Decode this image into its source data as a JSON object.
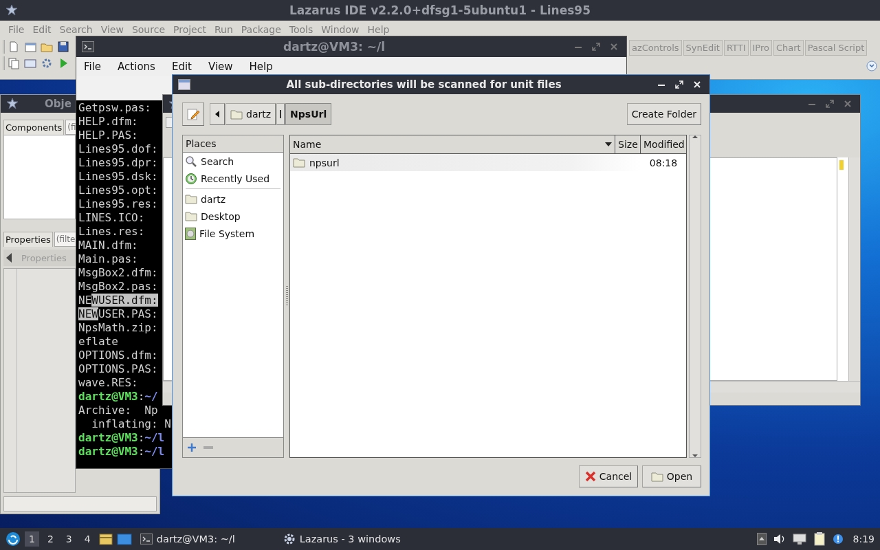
{
  "ide_window": {
    "title": "Lazarus IDE v2.2.0+dfsg1-5ubuntu1 - Lines95",
    "menu": [
      "File",
      "Edit",
      "Search",
      "View",
      "Source",
      "Project",
      "Run",
      "Package",
      "Tools",
      "Window",
      "Help"
    ],
    "palette_tabs": [
      "azControls",
      "SynEdit",
      "RTTI",
      "IPro",
      "Chart",
      "Pascal Script"
    ]
  },
  "object_inspector": {
    "title": "Obje",
    "components_tab": "Components",
    "components_filter": {
      "placeholder": "(fi"
    },
    "properties_tab": "Properties",
    "properties_filter": {
      "placeholder": "(filte"
    },
    "grid_header": "Properties"
  },
  "terminal": {
    "title": "dartz@VM3: ~/l",
    "menu": [
      "File",
      "Actions",
      "Edit",
      "View",
      "Help"
    ],
    "lines": [
      [
        {
          "text": "Getpsw.pas:",
          "kind": "plain"
        }
      ],
      [
        {
          "text": "HELP.dfm:",
          "kind": "plain"
        }
      ],
      [
        {
          "text": "HELP.PAS:",
          "kind": "plain"
        }
      ],
      [
        {
          "text": "Lines95.dof:",
          "kind": "plain"
        }
      ],
      [
        {
          "text": "Lines95.dpr:",
          "kind": "plain"
        }
      ],
      [
        {
          "text": "Lines95.dsk:",
          "kind": "plain"
        }
      ],
      [
        {
          "text": "Lines95.opt:",
          "kind": "plain"
        }
      ],
      [
        {
          "text": "Lines95.res:",
          "kind": "plain"
        }
      ],
      [
        {
          "text": "LINES.ICO:",
          "kind": "plain"
        }
      ],
      [
        {
          "text": "Lines.res:",
          "kind": "plain"
        }
      ],
      [
        {
          "text": "MAIN.dfm:",
          "kind": "plain"
        }
      ],
      [
        {
          "text": "Main.pas:",
          "kind": "plain"
        }
      ],
      [
        {
          "text": "MsgBox2.dfm:",
          "kind": "plain"
        }
      ],
      [
        {
          "text": "MsgBox2.pas:",
          "kind": "plain"
        }
      ],
      [
        {
          "text": "NE",
          "kind": "plain"
        },
        {
          "text": "WUSER.dfm:",
          "kind": "selected"
        }
      ],
      [
        {
          "text": "NEW",
          "kind": "selected"
        },
        {
          "text": "USER.PAS:",
          "kind": "plain"
        }
      ],
      [
        {
          "text": "NpsMath.zip:",
          "kind": "plain"
        }
      ],
      [
        {
          "text": "eflate",
          "kind": "plain"
        }
      ],
      [
        {
          "text": "OPTIONS.dfm:",
          "kind": "plain"
        }
      ],
      [
        {
          "text": "OPTIONS.PAS:",
          "kind": "plain"
        }
      ],
      [
        {
          "text": "wave.RES:",
          "kind": "plain"
        }
      ],
      [
        {
          "text": "dartz@VM3",
          "kind": "user"
        },
        {
          "text": ":",
          "kind": "plain"
        },
        {
          "text": "~/",
          "kind": "path"
        }
      ],
      [
        {
          "text": "Archive:  Np",
          "kind": "plain"
        }
      ],
      [
        {
          "text": "  inflating: N",
          "kind": "plain"
        }
      ],
      [
        {
          "text": "dartz@VM3",
          "kind": "user"
        },
        {
          "text": ":",
          "kind": "plain"
        },
        {
          "text": "~/l",
          "kind": "path"
        }
      ],
      [
        {
          "text": "dartz@VM3",
          "kind": "user"
        },
        {
          "text": ":",
          "kind": "plain"
        },
        {
          "text": "~/l",
          "kind": "path"
        }
      ]
    ]
  },
  "dialog": {
    "title": "All sub-directories will be scanned for unit files",
    "path": [
      {
        "label": "dartz",
        "selected": false
      },
      {
        "label": "NpsUrl",
        "selected": true
      }
    ],
    "create_folder": "Create Folder",
    "places_header": "Places",
    "places": [
      {
        "label": "Search",
        "kind": "search"
      },
      {
        "label": "Recently Used",
        "kind": "recent"
      }
    ],
    "bookmarks": [
      {
        "label": "dartz",
        "kind": "folder"
      },
      {
        "label": "Desktop",
        "kind": "folder"
      },
      {
        "label": "File System",
        "kind": "drive"
      }
    ],
    "columns": [
      "Name",
      "Size",
      "Modified"
    ],
    "files": [
      {
        "name": "npsurl",
        "modified": "08:18",
        "selected": true
      }
    ],
    "buttons": [
      {
        "label": "Cancel",
        "kind": "cancel"
      },
      {
        "label": "Open",
        "kind": "open"
      }
    ]
  },
  "taskbar": {
    "workspaces": [
      {
        "label": "1",
        "selected": true
      },
      {
        "label": "2",
        "selected": false
      },
      {
        "label": "3",
        "selected": false
      },
      {
        "label": "4",
        "selected": false
      }
    ],
    "tasks": [
      {
        "label": "dartz@VM3: ~/l",
        "kind": "terminal"
      },
      {
        "label": "Lazarus - 3 windows",
        "kind": "lazarus"
      }
    ],
    "clock": "8:19"
  }
}
